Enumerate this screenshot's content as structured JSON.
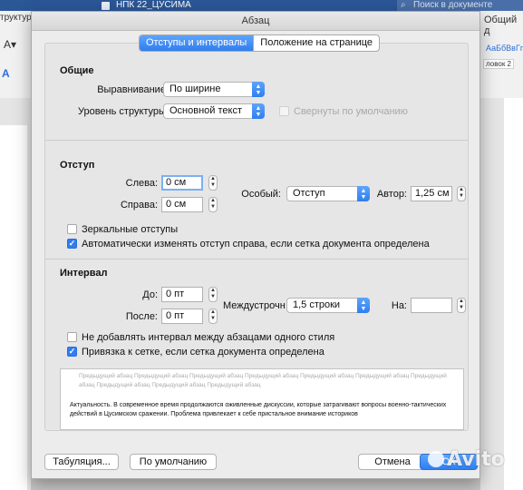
{
  "background": {
    "titlebar": {
      "document_title": "НПК 22_ЦУСИМА",
      "search_placeholder": "Поиск в документе"
    },
    "ribbon": {
      "left_label": "труктур",
      "share_label": "Общий д",
      "style_sample": "АаБбВвГгД",
      "style_name": "ловок 2"
    }
  },
  "dialog": {
    "title": "Абзац",
    "tabs": [
      {
        "label": "Отступы и интервалы",
        "active": true
      },
      {
        "label": "Положение на странице",
        "active": false
      }
    ],
    "general": {
      "heading": "Общие",
      "alignment_label": "Выравнивание:",
      "alignment_value": "По ширине",
      "outline_label": "Уровень структуры:",
      "outline_value": "Основной текст",
      "collapsed_label": "Свернуты по умолчанию",
      "collapsed_checked": false
    },
    "indent": {
      "heading": "Отступ",
      "left_label": "Слева:",
      "left_value": "0 см",
      "right_label": "Справа:",
      "right_value": "0 см",
      "special_label": "Особый:",
      "special_value": "Отступ",
      "by_label": "Автор:",
      "by_value": "1,25 см",
      "mirror_label": "Зеркальные отступы",
      "mirror_checked": false,
      "auto_label": "Автоматически изменять отступ справа, если сетка документа определена",
      "auto_checked": true
    },
    "spacing": {
      "heading": "Интервал",
      "before_label": "До:",
      "before_value": "0 пт",
      "after_label": "После:",
      "after_value": "0 пт",
      "line_label": "Междустрочн",
      "line_value": "1,5 строки",
      "at_label": "На:",
      "at_value": "",
      "no_space_label": "Не добавлять интервал между абзацами одного стиля",
      "no_space_checked": false,
      "snap_label": "Привязка к сетке, если сетка документа определена",
      "snap_checked": true
    },
    "preview": {
      "previous": "Предыдущий абзац Предыдущий абзац Предыдущий абзац Предыдущий абзац Предыдущий абзац Предыдущий абзац Предыдущий абзац Предыдущий абзац Предыдущий абзац Предыдущий абзац",
      "current": "Актуальность. В современное время продолжаются оживленные дискуссии, которые затрагивают вопросы военно-тактических действий в Цусимском сражении. Проблема привлекает к себе пристальное внимание историков"
    },
    "buttons": {
      "tabs": "Табуляция...",
      "default": "По умолчанию",
      "cancel": "Отмена",
      "ok": "ОК"
    }
  },
  "watermark": "Avito"
}
